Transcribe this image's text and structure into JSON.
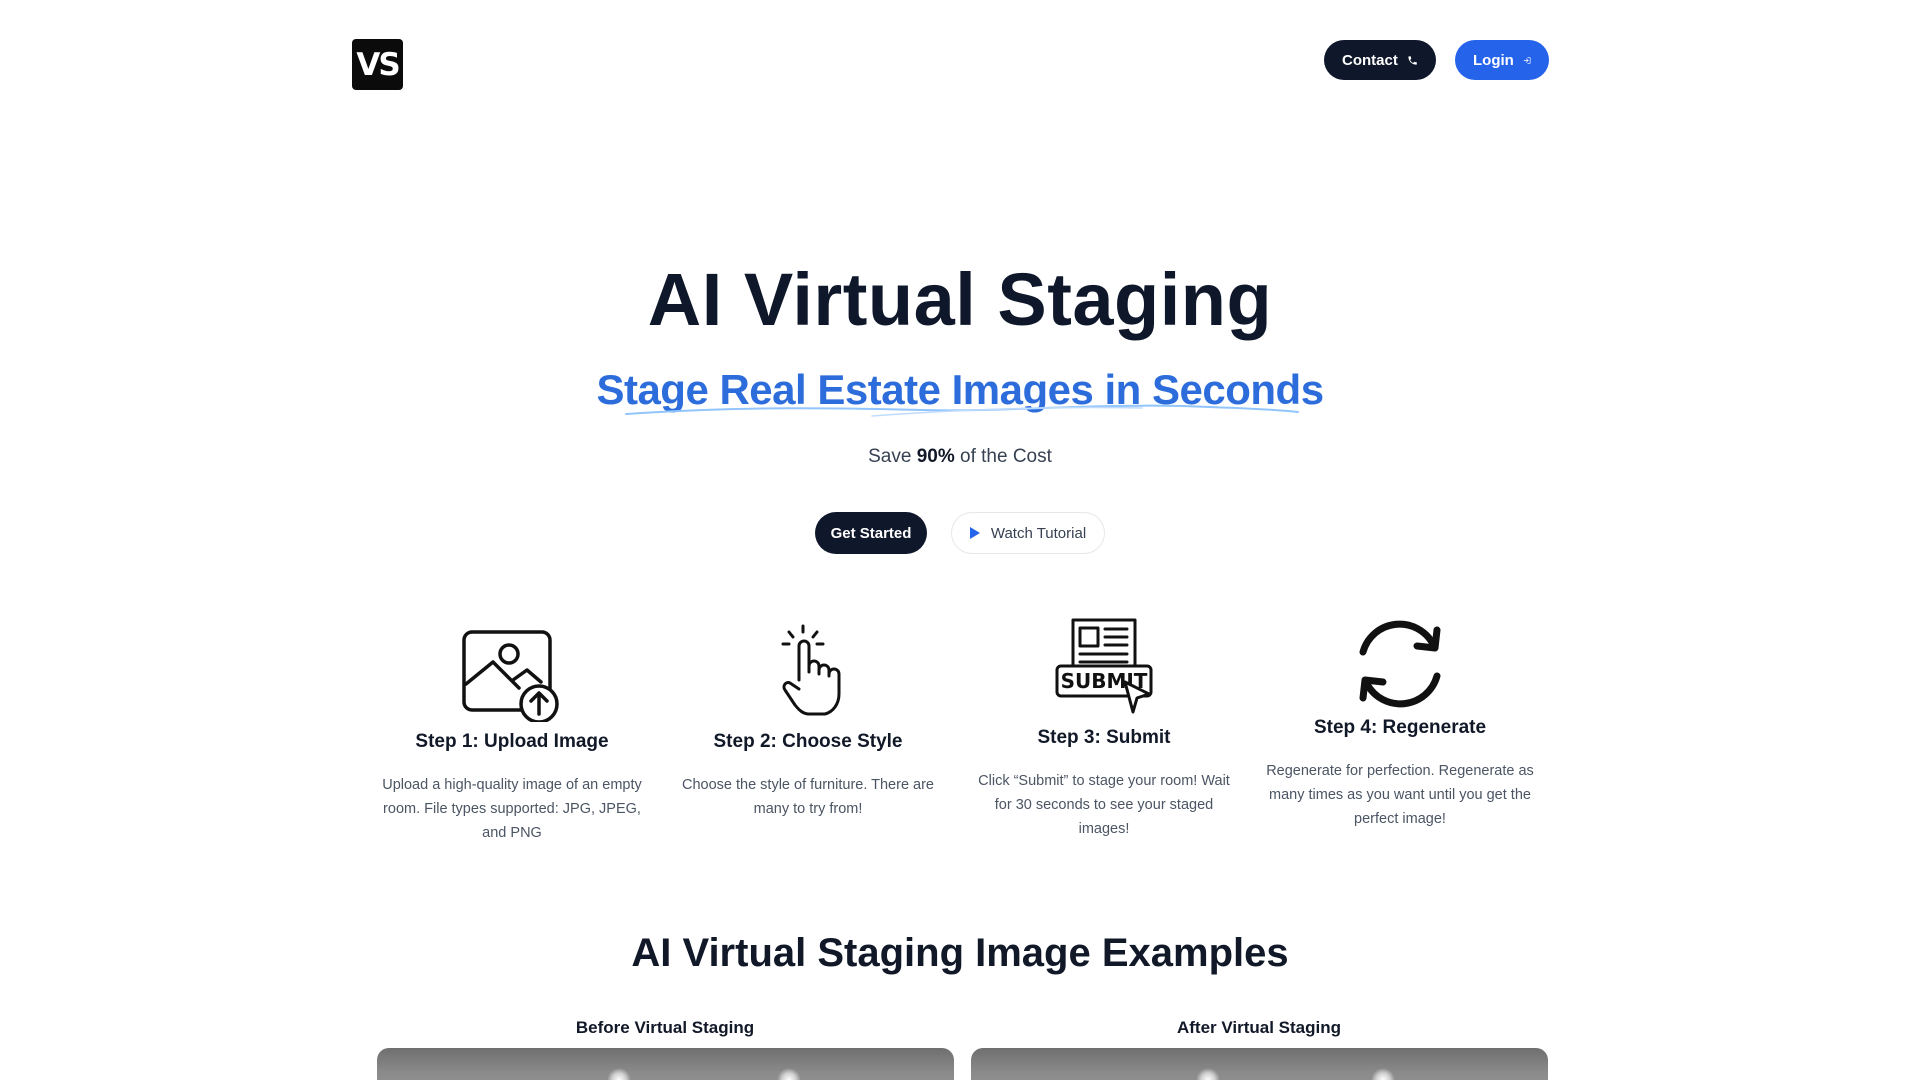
{
  "header": {
    "logo_text": "VS",
    "contact_label": "Contact",
    "login_label": "Login"
  },
  "hero": {
    "title": "AI Virtual Staging",
    "subtitle": "Stage Real Estate Images in Seconds",
    "save_prefix": "Save ",
    "save_bold": "90%",
    "save_suffix": " of the Cost",
    "get_started_label": "Get Started",
    "watch_tutorial_label": "Watch Tutorial"
  },
  "steps": [
    {
      "icon": "upload-image-icon",
      "title": "Step 1: Upload Image",
      "description": "Upload a high-quality image of an empty room. File types supported: JPG, JPEG, and PNG"
    },
    {
      "icon": "pointer-hand-icon",
      "title": "Step 2: Choose Style",
      "description": "Choose the style of furniture. There are many to try from!"
    },
    {
      "icon": "submit-form-icon",
      "title": "Step 3: Submit",
      "description": "Click “Submit” to stage your room! Wait for 30 seconds to see your staged images!"
    },
    {
      "icon": "refresh-icon",
      "title": "Step 4: Regenerate",
      "description": "Regenerate for perfection. Regenerate as many times as you want until you get the perfect image!"
    }
  ],
  "submit_icon_text": "SUBMIT",
  "examples": {
    "title": "AI Virtual Staging Image Examples",
    "before_label": "Before Virtual Staging",
    "after_label": "After Virtual Staging"
  },
  "colors": {
    "dark": "#0f172a",
    "accent_blue": "#2563eb",
    "subtitle_blue": "#2d6ddb"
  }
}
